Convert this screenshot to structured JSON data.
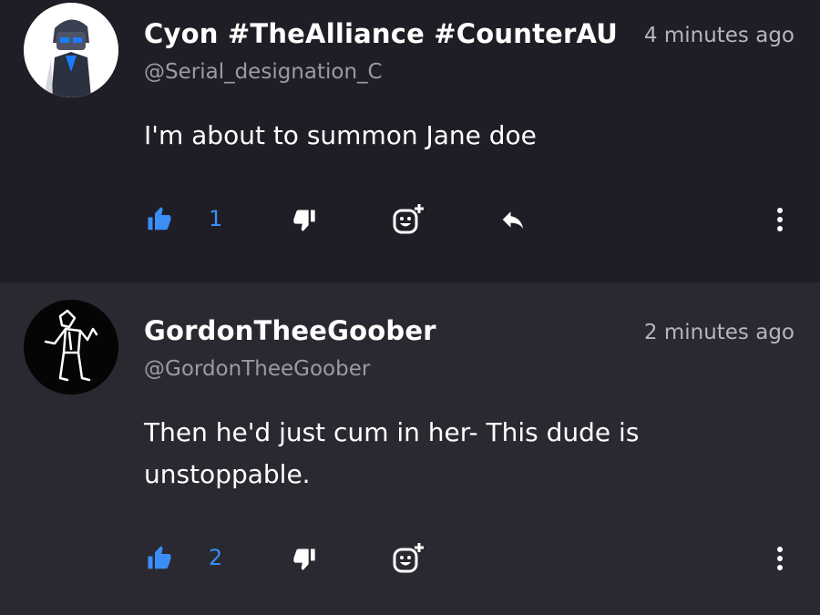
{
  "comments": [
    {
      "display_name": "Cyon #TheAlliance #CounterAU",
      "handle": "@Serial_designation_C",
      "time": "4 minutes ago",
      "text": "I'm about to summon Jane doe",
      "likes": "1"
    },
    {
      "display_name": "GordonTheeGoober",
      "handle": "@GordonTheeGoober",
      "time": "2 minutes ago",
      "text": "Then he'd just cum in her- This dude is unstoppable.",
      "likes": "2"
    }
  ],
  "icons": {
    "like": "thumbs-up-icon",
    "dislike": "thumbs-down-icon",
    "react": "add-reaction-icon",
    "reply": "reply-icon",
    "more": "more-vertical-icon"
  },
  "colors": {
    "accent": "#3a8ef6",
    "background_top": "#1f1e26",
    "background_bottom": "#2a2931",
    "muted_text": "#9c9aa6"
  }
}
